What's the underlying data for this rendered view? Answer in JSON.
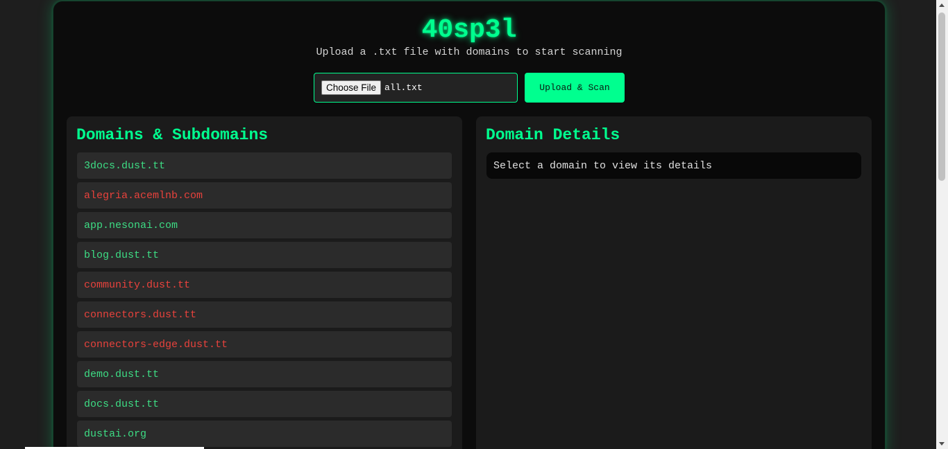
{
  "app": {
    "title": "40sp3l",
    "subtitle": "Upload a .txt file with domains to start scanning"
  },
  "upload": {
    "choose_label": "Choose File",
    "file_name": "all.txt",
    "scan_label": "Upload & Scan"
  },
  "domains_panel": {
    "title": "Domains & Subdomains",
    "items": [
      {
        "label": "3docs.dust.tt",
        "status": "active"
      },
      {
        "label": "alegria.acemlnb.com",
        "status": "inactive"
      },
      {
        "label": "app.nesonai.com",
        "status": "active"
      },
      {
        "label": "blog.dust.tt",
        "status": "active"
      },
      {
        "label": "community.dust.tt",
        "status": "inactive"
      },
      {
        "label": "connectors.dust.tt",
        "status": "inactive"
      },
      {
        "label": "connectors-edge.dust.tt",
        "status": "inactive"
      },
      {
        "label": "demo.dust.tt",
        "status": "active"
      },
      {
        "label": "docs.dust.tt",
        "status": "active"
      },
      {
        "label": "dustai.org",
        "status": "active"
      }
    ]
  },
  "details_panel": {
    "title": "Domain Details",
    "placeholder": "Select a domain to view its details"
  },
  "colors": {
    "accent": "#00ff8f",
    "active": "#3ddc84",
    "inactive": "#e8423c",
    "background": "#1e1e1e"
  }
}
